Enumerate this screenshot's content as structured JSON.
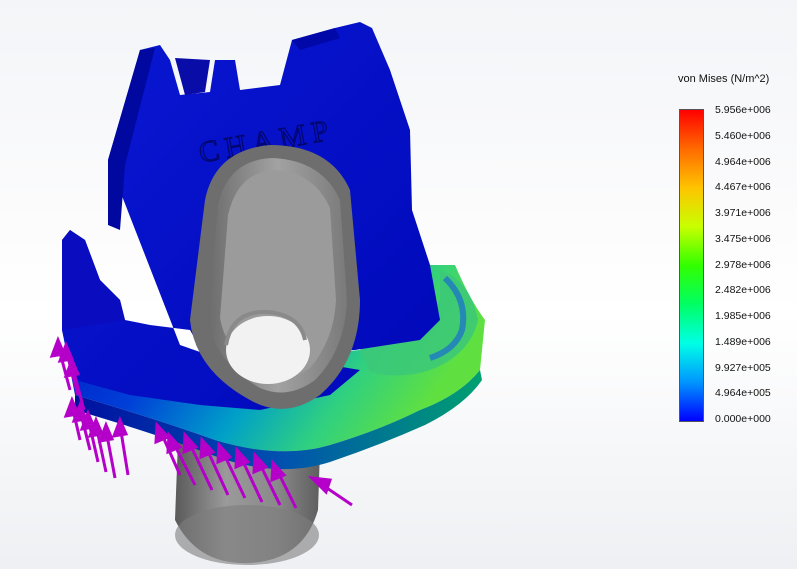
{
  "legend": {
    "title": "von Mises (N/m^2)",
    "colors": [
      "#ff0000",
      "#ff6a00",
      "#ffc400",
      "#c8ff00",
      "#32ff00",
      "#00ff64",
      "#00ffe6",
      "#0096ff",
      "#0000ff"
    ],
    "values": [
      "5.956e+006",
      "5.460e+006",
      "4.964e+006",
      "4.467e+006",
      "3.971e+006",
      "3.475e+006",
      "2.978e+006",
      "2.482e+006",
      "1.985e+006",
      "1.489e+006",
      "9.927e+005",
      "4.964e+005",
      "0.000e+000"
    ]
  },
  "model": {
    "engraved_text": "CHAMP",
    "part_color": "#0a14c8",
    "tube_color": "#8a8a8a",
    "load_arrow_color": "#b400c8"
  }
}
